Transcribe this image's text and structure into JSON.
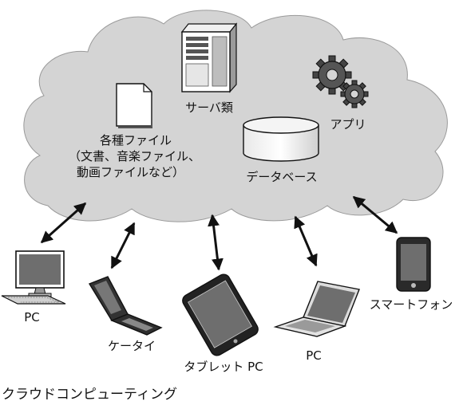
{
  "cloud": {
    "files_label": "各種ファイル",
    "files_detail_1": "（文書、音楽ファイル、",
    "files_detail_2": "動画ファイルなど）",
    "servers_label": "サーバ類",
    "apps_label": "アプリ",
    "database_label": "データベース"
  },
  "devices": {
    "pc_desktop": "PC",
    "mobile_phone": "ケータイ",
    "tablet": "タブレット PC",
    "pc_laptop": "PC",
    "smartphone": "スマートフォン"
  },
  "caption": "クラウドコンピューティング",
  "icons": [
    "document-icon",
    "server-icon",
    "gear-icon",
    "database-icon",
    "desktop-pc-icon",
    "flip-phone-icon",
    "tablet-icon",
    "laptop-icon",
    "smartphone-icon"
  ],
  "colors": {
    "cloud_fill": "#d4d4d4",
    "screen_fill": "#6e6e6e",
    "line": "#111111"
  }
}
